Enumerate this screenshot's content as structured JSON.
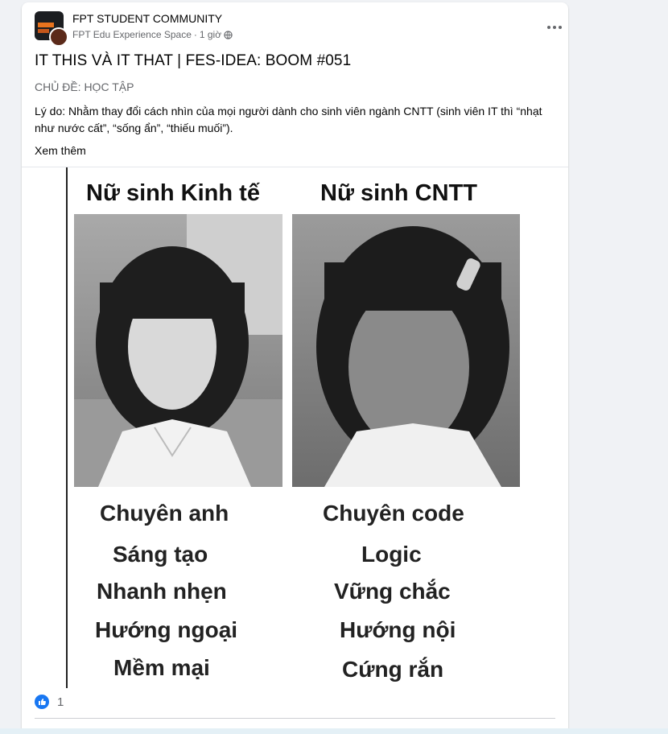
{
  "post": {
    "group_name": "FPT STUDENT COMMUNITY",
    "author": "FPT Edu Experience Space",
    "separator": "·",
    "time": "1 giờ",
    "title": "IT THIS VÀ IT THAT | FES-IDEA: BOOM #051",
    "topic": "CHỦ ĐỀ: HỌC TẬP",
    "reason": "Lý do: Nhằm thay đổi cách nhìn của mọi người dành cho sinh viên ngành CNTT (sinh viên IT thì “nhạt như nước cất”, “sống ẩn”, “thiếu muối”).",
    "see_more": "Xem thêm"
  },
  "meme": {
    "left_title": "Nữ sinh Kinh tế",
    "right_title": "Nữ sinh CNTT",
    "left_traits": [
      "Chuyên anh",
      "Sáng tạo",
      "Nhanh nhẹn",
      "Hướng ngoại",
      "Mềm mại"
    ],
    "right_traits": [
      "Chuyên code",
      "Logic",
      "Vững chắc",
      "Hướng nội",
      "Cứng rắn"
    ]
  },
  "reactions": {
    "like_count": "1"
  },
  "colors": {
    "primary": "#1877f2",
    "secondary_text": "#65676b",
    "background": "#f0f2f5"
  },
  "icons": [
    "globe-icon",
    "more-icon",
    "like-icon"
  ]
}
